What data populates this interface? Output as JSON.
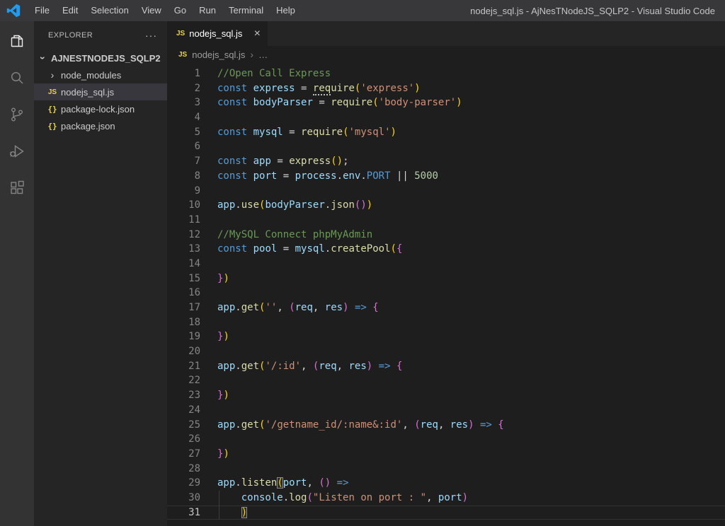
{
  "window": {
    "title": "nodejs_sql.js - AjNesTNodeJS_SQLP2 - Visual Studio Code"
  },
  "menu": {
    "items": [
      "File",
      "Edit",
      "Selection",
      "View",
      "Go",
      "Run",
      "Terminal",
      "Help"
    ]
  },
  "activity_bar": {
    "items": [
      {
        "name": "explorer",
        "active": true
      },
      {
        "name": "search",
        "active": false
      },
      {
        "name": "source-control",
        "active": false
      },
      {
        "name": "run-and-debug",
        "active": false
      },
      {
        "name": "extensions",
        "active": false
      }
    ]
  },
  "sidebar": {
    "header": "EXPLORER",
    "actions": "···",
    "root": {
      "label": "AJNESTNODEJS_SQLP2",
      "chevron": "›"
    },
    "items": [
      {
        "label": "node_modules",
        "type": "folder",
        "chevron": "›",
        "selected": false
      },
      {
        "label": "nodejs_sql.js",
        "type": "js",
        "icon_text": "JS",
        "selected": true
      },
      {
        "label": "package-lock.json",
        "type": "json",
        "icon_text": "{}",
        "selected": false
      },
      {
        "label": "package.json",
        "type": "json",
        "icon_text": "{}",
        "selected": false
      }
    ]
  },
  "editor": {
    "tab": {
      "label": "nodejs_sql.js",
      "icon_text": "JS",
      "close": "×"
    },
    "breadcrumb": {
      "icon_text": "JS",
      "file": "nodejs_sql.js",
      "separator": "›",
      "more": "…"
    },
    "code": {
      "token_colors": {
        "kw": "#569cd6",
        "var": "#9cdcfe",
        "fn": "#dcdcaa",
        "str": "#ce9178",
        "num": "#b5cea8",
        "cm": "#6a9955",
        "pl": "#d4d4d4",
        "b1": "#ffd700",
        "b2": "#da70d6"
      },
      "lines": [
        {
          "n": 1,
          "t": [
            [
              "//Open Call Express",
              "cm"
            ]
          ]
        },
        {
          "n": 2,
          "t": [
            [
              "const",
              "kw"
            ],
            [
              " ",
              "pl"
            ],
            [
              "express",
              "var"
            ],
            [
              " = ",
              "pl"
            ],
            [
              "req",
              "fn hint"
            ],
            [
              "uire",
              "fn"
            ],
            [
              "(",
              "b1"
            ],
            [
              "'express'",
              "str"
            ],
            [
              ")",
              "b1"
            ]
          ]
        },
        {
          "n": 3,
          "t": [
            [
              "const",
              "kw"
            ],
            [
              " ",
              "pl"
            ],
            [
              "bodyParser",
              "var"
            ],
            [
              " = ",
              "pl"
            ],
            [
              "require",
              "fn"
            ],
            [
              "(",
              "b1"
            ],
            [
              "'body-parser'",
              "str"
            ],
            [
              ")",
              "b1"
            ]
          ]
        },
        {
          "n": 4,
          "t": []
        },
        {
          "n": 5,
          "t": [
            [
              "const",
              "kw"
            ],
            [
              " ",
              "pl"
            ],
            [
              "mysql",
              "var"
            ],
            [
              " = ",
              "pl"
            ],
            [
              "require",
              "fn"
            ],
            [
              "(",
              "b1"
            ],
            [
              "'mysql'",
              "str"
            ],
            [
              ")",
              "b1"
            ]
          ]
        },
        {
          "n": 6,
          "t": []
        },
        {
          "n": 7,
          "t": [
            [
              "const",
              "kw"
            ],
            [
              " ",
              "pl"
            ],
            [
              "app",
              "var"
            ],
            [
              " = ",
              "pl"
            ],
            [
              "express",
              "fn"
            ],
            [
              "(",
              "b1"
            ],
            [
              ")",
              "b1"
            ],
            [
              ";",
              "pl"
            ]
          ]
        },
        {
          "n": 8,
          "t": [
            [
              "const",
              "kw"
            ],
            [
              " ",
              "pl"
            ],
            [
              "port",
              "var"
            ],
            [
              " = ",
              "pl"
            ],
            [
              "process",
              "var"
            ],
            [
              ".",
              "pl"
            ],
            [
              "env",
              "var"
            ],
            [
              ".",
              "pl"
            ],
            [
              "PORT",
              "kw"
            ],
            [
              " || ",
              "pl"
            ],
            [
              "5000",
              "num"
            ]
          ]
        },
        {
          "n": 9,
          "t": []
        },
        {
          "n": 10,
          "t": [
            [
              "app",
              "var"
            ],
            [
              ".",
              "pl"
            ],
            [
              "use",
              "fn"
            ],
            [
              "(",
              "b1"
            ],
            [
              "bodyParser",
              "var"
            ],
            [
              ".",
              "pl"
            ],
            [
              "json",
              "fn"
            ],
            [
              "(",
              "b2"
            ],
            [
              ")",
              "b2"
            ],
            [
              ")",
              "b1"
            ]
          ]
        },
        {
          "n": 11,
          "t": []
        },
        {
          "n": 12,
          "t": [
            [
              "//MySQL Connect phpMyAdmin",
              "cm"
            ]
          ]
        },
        {
          "n": 13,
          "t": [
            [
              "const",
              "kw"
            ],
            [
              " ",
              "pl"
            ],
            [
              "pool",
              "var"
            ],
            [
              " = ",
              "pl"
            ],
            [
              "mysql",
              "var"
            ],
            [
              ".",
              "pl"
            ],
            [
              "createPool",
              "fn"
            ],
            [
              "(",
              "b1"
            ],
            [
              "{",
              "b2"
            ]
          ]
        },
        {
          "n": 14,
          "t": []
        },
        {
          "n": 15,
          "t": [
            [
              "}",
              "b2"
            ],
            [
              ")",
              "b1"
            ]
          ]
        },
        {
          "n": 16,
          "t": []
        },
        {
          "n": 17,
          "t": [
            [
              "app",
              "var"
            ],
            [
              ".",
              "pl"
            ],
            [
              "get",
              "fn"
            ],
            [
              "(",
              "b1"
            ],
            [
              "''",
              "str"
            ],
            [
              ", ",
              "pl"
            ],
            [
              "(",
              "b2"
            ],
            [
              "req",
              "var"
            ],
            [
              ", ",
              "pl"
            ],
            [
              "res",
              "var"
            ],
            [
              ")",
              "b2"
            ],
            [
              " ",
              "pl"
            ],
            [
              "=>",
              "kw"
            ],
            [
              " ",
              "pl"
            ],
            [
              "{",
              "b2"
            ]
          ]
        },
        {
          "n": 18,
          "t": []
        },
        {
          "n": 19,
          "t": [
            [
              "}",
              "b2"
            ],
            [
              ")",
              "b1"
            ]
          ]
        },
        {
          "n": 20,
          "t": []
        },
        {
          "n": 21,
          "t": [
            [
              "app",
              "var"
            ],
            [
              ".",
              "pl"
            ],
            [
              "get",
              "fn"
            ],
            [
              "(",
              "b1"
            ],
            [
              "'/:id'",
              "str"
            ],
            [
              ", ",
              "pl"
            ],
            [
              "(",
              "b2"
            ],
            [
              "req",
              "var"
            ],
            [
              ", ",
              "pl"
            ],
            [
              "res",
              "var"
            ],
            [
              ")",
              "b2"
            ],
            [
              " ",
              "pl"
            ],
            [
              "=>",
              "kw"
            ],
            [
              " ",
              "pl"
            ],
            [
              "{",
              "b2"
            ]
          ]
        },
        {
          "n": 22,
          "t": []
        },
        {
          "n": 23,
          "t": [
            [
              "}",
              "b2"
            ],
            [
              ")",
              "b1"
            ]
          ]
        },
        {
          "n": 24,
          "t": []
        },
        {
          "n": 25,
          "t": [
            [
              "app",
              "var"
            ],
            [
              ".",
              "pl"
            ],
            [
              "get",
              "fn"
            ],
            [
              "(",
              "b1"
            ],
            [
              "'/getname_id/:name&:id'",
              "str"
            ],
            [
              ", ",
              "pl"
            ],
            [
              "(",
              "b2"
            ],
            [
              "req",
              "var"
            ],
            [
              ", ",
              "pl"
            ],
            [
              "res",
              "var"
            ],
            [
              ")",
              "b2"
            ],
            [
              " ",
              "pl"
            ],
            [
              "=>",
              "kw"
            ],
            [
              " ",
              "pl"
            ],
            [
              "{",
              "b2"
            ]
          ]
        },
        {
          "n": 26,
          "t": []
        },
        {
          "n": 27,
          "t": [
            [
              "}",
              "b2"
            ],
            [
              ")",
              "b1"
            ]
          ]
        },
        {
          "n": 28,
          "t": []
        },
        {
          "n": 29,
          "t": [
            [
              "app",
              "var"
            ],
            [
              ".",
              "pl"
            ],
            [
              "listen",
              "fn"
            ],
            [
              "(",
              "b1 match"
            ],
            [
              "port",
              "var"
            ],
            [
              ", ",
              "pl"
            ],
            [
              "(",
              "b2"
            ],
            [
              ")",
              "b2"
            ],
            [
              " ",
              "pl"
            ],
            [
              "=>",
              "kw"
            ]
          ]
        },
        {
          "n": 30,
          "t": [
            [
              "    ",
              "pl"
            ],
            [
              "console",
              "var"
            ],
            [
              ".",
              "pl"
            ],
            [
              "log",
              "fn"
            ],
            [
              "(",
              "b2"
            ],
            [
              "\"Listen on port : \"",
              "str"
            ],
            [
              ", ",
              "pl"
            ],
            [
              "port",
              "var"
            ],
            [
              ")",
              "b2"
            ]
          ],
          "g": true
        },
        {
          "n": 31,
          "t": [
            [
              "    ",
              "pl"
            ],
            [
              ")",
              "b1 match"
            ]
          ],
          "g": true,
          "cur": true
        }
      ]
    }
  },
  "colors": {
    "titlebar": "#38383a",
    "activity_bar": "#333333",
    "sidebar": "#252526",
    "editor_bg": "#1e1e1e",
    "tab_strip": "#252526",
    "selected_item_bg": "#37373d",
    "badge_yellow": "#e8d44d",
    "logo_blue": "#1f9cf0",
    "line_number": "#858585",
    "active_line_number": "#c6c6c6"
  }
}
